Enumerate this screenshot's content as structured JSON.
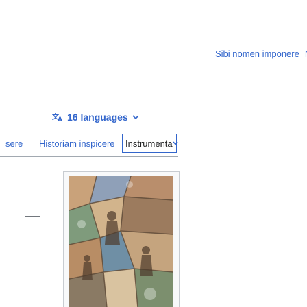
{
  "personal": {
    "links": [
      "Sibi nomen imponere",
      "Nc"
    ]
  },
  "languages": {
    "label": "16 languages",
    "icon": "translate-icon",
    "chevron": "chevron-down-icon"
  },
  "tabs": {
    "items": [
      "sere",
      "Historiam inspicere"
    ],
    "tools_label": "Instrumenta"
  },
  "figure": {
    "alt": "illustration"
  },
  "colors": {
    "link": "#3366cc",
    "text": "#202122",
    "border": "#a2a9b1"
  }
}
